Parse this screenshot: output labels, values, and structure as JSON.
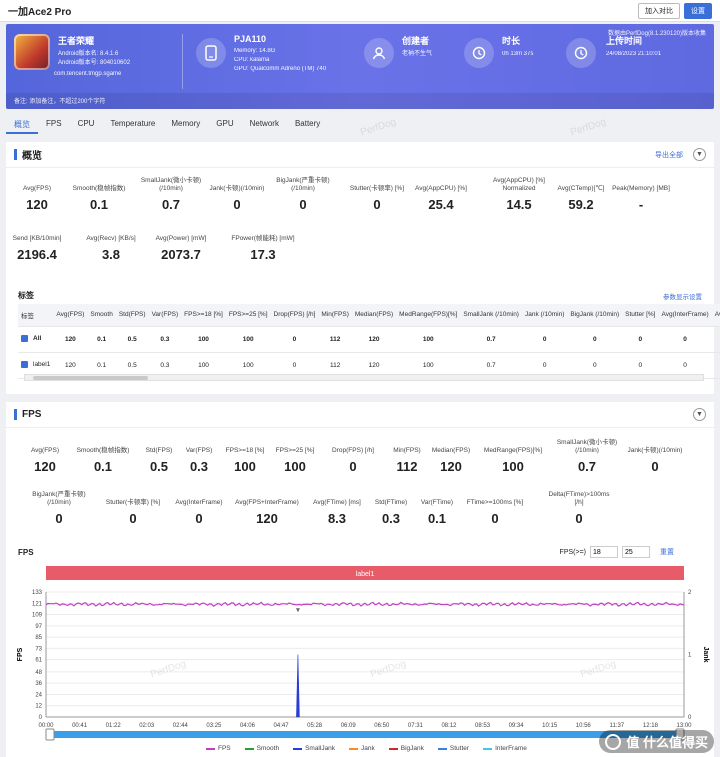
{
  "window": {
    "title": "一加Ace2 Pro",
    "add_compare": "加入对比",
    "settings": "设置"
  },
  "banner": {
    "version": "数据由PerfDog(8.1.230120)版本收集",
    "app_name": "王者荣耀",
    "android_ver": "Android版本名: 8.4.1.6",
    "android_code": "Android版本号: 804010602",
    "package": "com.tencent.tmgp.sgame",
    "device": "PJA110",
    "memory": "Memory: 14.8G",
    "cpu": "CPU: kalama",
    "gpu": "GPU: Qualcomm Adreno (TM) 740",
    "creator_label": "创建者",
    "creator_value": "老衲不生气",
    "duration_label": "时长",
    "duration_value": "0h 13m 37s",
    "upload_label": "上传时间",
    "upload_value": "24/08/2023 21:10:01",
    "note": "备注: 添加备注，不超过200个字符"
  },
  "tabs": [
    "概览",
    "FPS",
    "CPU",
    "Temperature",
    "Memory",
    "GPU",
    "Network",
    "Battery"
  ],
  "overview": {
    "title": "概览",
    "export": "导出全部",
    "metrics_row1": [
      {
        "label": "Avg(FPS)",
        "value": "120"
      },
      {
        "label": "Smooth(稳帧指数)",
        "value": "0.1"
      },
      {
        "label": "SmallJank(微小卡顿)(/10min)",
        "value": "0.7"
      },
      {
        "label": "Jank(卡顿)(/10min)",
        "value": "0"
      },
      {
        "label": "BigJank(严重卡顿)(/10min)",
        "value": "0"
      },
      {
        "label": "Stutter(卡顿率) [%]",
        "value": "0"
      },
      {
        "label": "Avg(AppCPU) [%]",
        "value": "25.4"
      },
      {
        "label": "Avg(AppCPU) [%] Normalized",
        "value": "14.5"
      },
      {
        "label": "Avg(CTemp)[℃]",
        "value": "59.2"
      },
      {
        "label": "Peak(Memory) [MB]",
        "value": "-"
      }
    ],
    "metrics_row2": [
      {
        "label": "Send [KB/10min]",
        "value": "2196.4"
      },
      {
        "label": "Avg(Recv) [KB/s]",
        "value": "3.8"
      },
      {
        "label": "Avg(Power) [mW]",
        "value": "2073.7"
      },
      {
        "label": "FPower(帧能耗) [mW]",
        "value": "17.3"
      }
    ],
    "label_section": "标签",
    "param_settings": "参数显示设置",
    "table_headers": [
      "标签",
      "Avg(FPS)",
      "Smooth",
      "Std(FPS)",
      "Var(FPS)",
      "FPS>=18 [%]",
      "FPS>=25 [%]",
      "Drop(FPS) [/h]",
      "Min(FPS)",
      "Median(FPS)",
      "MedRange(FPS)[%]",
      "SmallJank (/10min)",
      "Jank (/10min)",
      "BigJank (/10min)",
      "Stutter [%]",
      "Avg(InterFrame)",
      "Av"
    ],
    "table_rows": [
      {
        "label": "All",
        "cells": [
          "120",
          "0.1",
          "0.5",
          "0.3",
          "100",
          "100",
          "0",
          "112",
          "120",
          "100",
          "0.7",
          "0",
          "0",
          "0",
          "0",
          ""
        ]
      },
      {
        "label": "label1",
        "cells": [
          "120",
          "0.1",
          "0.5",
          "0.3",
          "100",
          "100",
          "0",
          "112",
          "120",
          "100",
          "0.7",
          "0",
          "0",
          "0",
          "0",
          ""
        ]
      }
    ]
  },
  "fps_panel": {
    "title": "FPS",
    "metrics_row1": [
      {
        "label": "Avg(FPS)",
        "value": "120"
      },
      {
        "label": "Smooth(稳帧指数)",
        "value": "0.1"
      },
      {
        "label": "Std(FPS)",
        "value": "0.5"
      },
      {
        "label": "Var(FPS)",
        "value": "0.3"
      },
      {
        "label": "FPS>=18 [%]",
        "value": "100"
      },
      {
        "label": "FPS>=25 [%]",
        "value": "100"
      },
      {
        "label": "Drop(FPS) [/h]",
        "value": "0"
      },
      {
        "label": "Min(FPS)",
        "value": "112"
      },
      {
        "label": "Median(FPS)",
        "value": "120"
      },
      {
        "label": "MedRange(FPS)[%]",
        "value": "100"
      },
      {
        "label": "SmallJank(微小卡顿)(/10min)",
        "value": "0.7"
      },
      {
        "label": "Jank(卡顿)(/10min)",
        "value": "0"
      }
    ],
    "metrics_row2": [
      {
        "label": "BigJank(严重卡顿)(/10min)",
        "value": "0"
      },
      {
        "label": "Stutter(卡顿率) [%]",
        "value": "0"
      },
      {
        "label": "Avg(InterFrame)",
        "value": "0"
      },
      {
        "label": "Avg(FPS+InterFrame)",
        "value": "120"
      },
      {
        "label": "Avg(FTime) [ms]",
        "value": "8.3"
      },
      {
        "label": "Std(FTime)",
        "value": "0.3"
      },
      {
        "label": "Var(FTime)",
        "value": "0.1"
      },
      {
        "label": "FTime>=100ms [%]",
        "value": "0"
      },
      {
        "label": "Delta(FTime)>100ms [/h]",
        "value": "0"
      }
    ],
    "chart_title": "FPS",
    "threshold_label": "FPS(>=)",
    "threshold1": "18",
    "threshold2": "25",
    "reset": "重置",
    "label_band": "label1"
  },
  "chart_data": {
    "type": "line",
    "y_left_label": "FPS",
    "y_right_label": "Jank",
    "y_ticks": [
      0,
      12,
      24,
      36,
      48,
      61,
      73,
      85,
      97,
      109,
      121,
      133
    ],
    "ylim": [
      0,
      133
    ],
    "y_right_ticks": [
      0,
      1,
      2
    ],
    "x_ticks": [
      "00:00",
      "00:41",
      "01:22",
      "02:03",
      "02:44",
      "03:25",
      "04:06",
      "04:47",
      "05:28",
      "06:09",
      "06:50",
      "07:31",
      "08:12",
      "08:53",
      "09:34",
      "10:15",
      "10:56",
      "11:37",
      "12:18",
      "13:00"
    ],
    "fps_level": 120,
    "smalljank_spike_time": "05:08",
    "smalljank_spike_value": 1,
    "legend": [
      {
        "name": "FPS",
        "color": "#c040c0"
      },
      {
        "name": "Smooth",
        "color": "#2ca02c"
      },
      {
        "name": "SmallJank",
        "color": "#2a3cd8"
      },
      {
        "name": "Jank",
        "color": "#ff8c1a"
      },
      {
        "name": "BigJank",
        "color": "#d62728"
      },
      {
        "name": "Stutter",
        "color": "#3a80e0"
      },
      {
        "name": "InterFrame",
        "color": "#40c8e0"
      }
    ]
  },
  "brand": {
    "name": "值 什么值得买"
  }
}
